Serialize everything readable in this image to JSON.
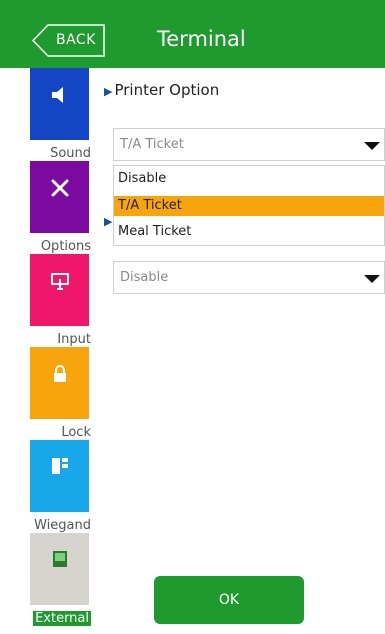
{
  "header": {
    "back_label": "BACK",
    "title": "Terminal"
  },
  "sidebar": {
    "items": [
      {
        "label": "Sound",
        "color": "#1546c6",
        "icon": "speaker-icon"
      },
      {
        "label": "Options",
        "color": "#7d0aa0",
        "icon": "tools-icon"
      },
      {
        "label": "Input",
        "color": "#f0176a",
        "icon": "display-icon"
      },
      {
        "label": "Lock",
        "color": "#f8a40c",
        "icon": "lock-icon"
      },
      {
        "label": "Wiegand",
        "color": "#18a7e8",
        "icon": "card-icon"
      },
      {
        "label": "External",
        "color": "#d7d4cf",
        "icon": "device-icon"
      }
    ]
  },
  "main": {
    "section_title": "Printer Option",
    "select1": {
      "value": "T/A Ticket"
    },
    "dropdown": {
      "options": [
        "Disable",
        "T/A Ticket",
        "Meal Ticket"
      ],
      "selected": "T/A Ticket"
    },
    "select2": {
      "value": "Disable"
    },
    "ok_label": "OK"
  },
  "colors": {
    "header": "#1f9a2e",
    "accent": "#f8a40c"
  }
}
